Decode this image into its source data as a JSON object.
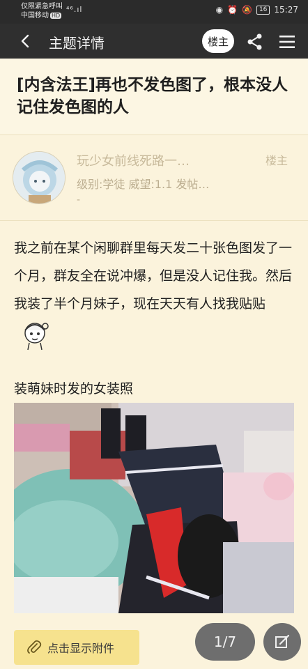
{
  "status_bar": {
    "line1": "仅限紧急呼叫",
    "carrier": "中国移动",
    "hd": "HD",
    "signal": "⁴⁶.ıl",
    "battery": "16",
    "time": "15:27"
  },
  "navbar": {
    "title": "主题详情",
    "louzhu_label": "楼主"
  },
  "post": {
    "title": "[内含法王]再也不发色图了，根本没人记住发色图的人"
  },
  "author": {
    "name": "玩少女前线死路一…",
    "tag": "楼主",
    "meta": "级别:学徒   威望:1.1   发帖…",
    "dash": "-"
  },
  "content": {
    "paragraph": "我之前在某个闲聊群里每天发二十张色图发了一个月，群友全在说冲爆，但是没人记住我。然后我装了半个月妹子，现在天天有人找我贴贴",
    "caption": "装萌妹时发的女装照"
  },
  "bottom_bar": {
    "attach_label": "点击显示附件",
    "pager": "1/7"
  },
  "colors": {
    "background": "#fbf3dc",
    "navbar": "#2f2f2f",
    "attach_button": "#f6e28e",
    "muted_text": "#c7b99a"
  },
  "icons": {
    "back": "chevron-left-icon",
    "share": "share-icon",
    "menu": "hamburger-menu-icon",
    "attach": "paperclip-icon",
    "edit": "edit-icon"
  }
}
